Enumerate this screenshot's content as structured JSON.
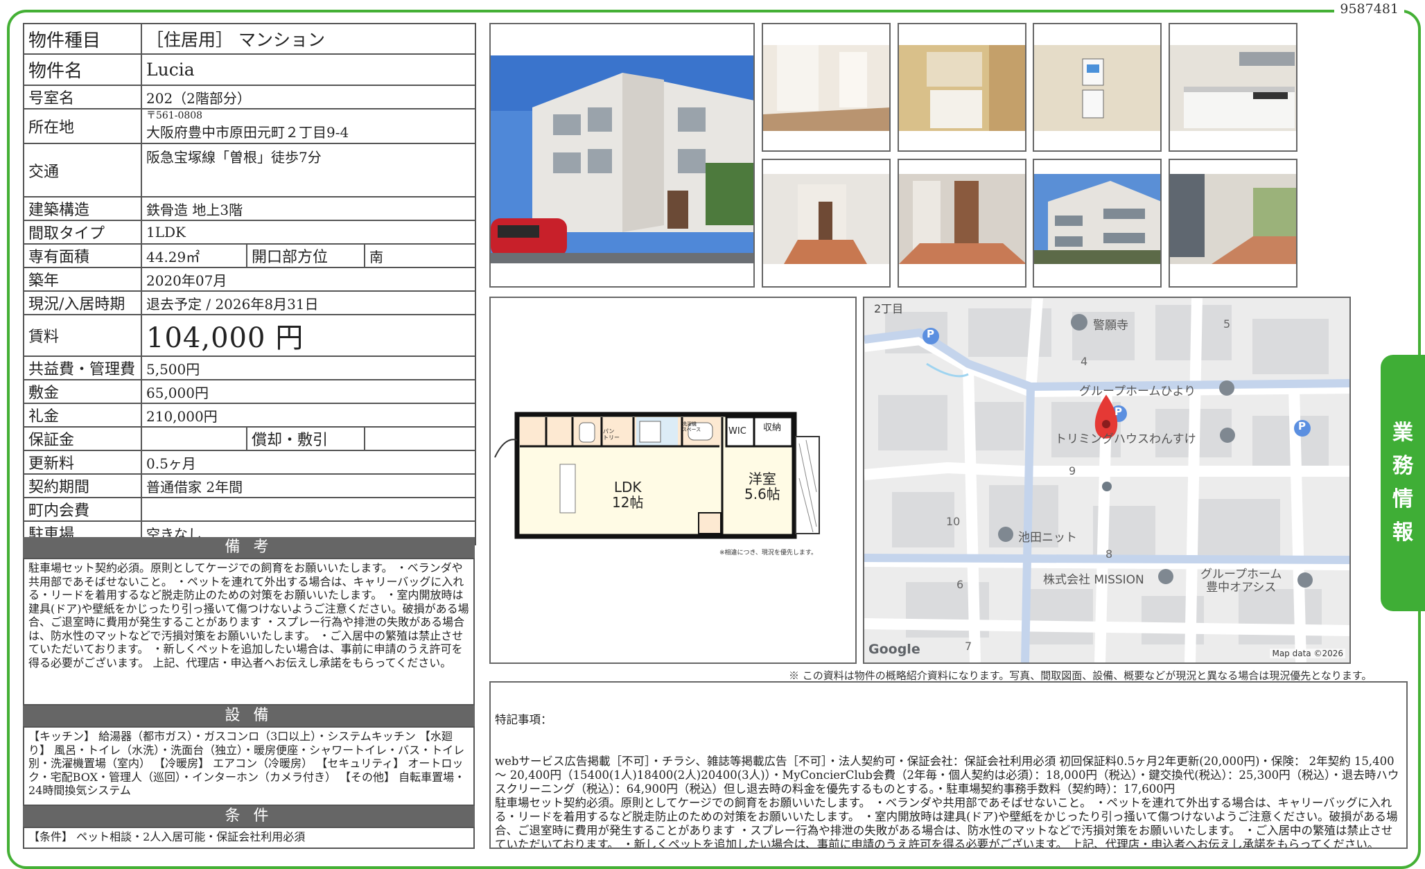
{
  "doc_id": "9587481",
  "side_tab": [
    "業",
    "務",
    "情",
    "報"
  ],
  "info": {
    "type_label": "物件種目",
    "type_value": "［住居用］ マンション",
    "name_label": "物件名",
    "name_value": "Lucia",
    "room_label": "号室名",
    "room_value": "202（2階部分）",
    "addr_label": "所在地",
    "addr_zip": "〒561-0808",
    "addr_value": "大阪府豊中市原田元町２丁目9-4",
    "access_label": "交通",
    "access_value": "阪急宝塚線「曽根」徒歩7分",
    "structure_label": "建築構造",
    "structure_value": "鉄骨造 地上3階",
    "layout_label": "間取タイプ",
    "layout_value": "1LDK",
    "area_label": "専有面積",
    "area_value": "44.29㎡",
    "orient_label": "開口部方位",
    "orient_value": "南",
    "built_label": "築年",
    "built_value": "2020年07月",
    "status_label": "現況/入居時期",
    "status_value": "退去予定 / 2026年8月31日",
    "rent_label": "賃料",
    "rent_value": "104,000",
    "rent_unit": "円",
    "common_label": "共益費・管理費",
    "common_value": "5,500円",
    "deposit_label": "敷金",
    "deposit_value": "65,000円",
    "key_label": "礼金",
    "key_value": "210,000円",
    "guarantee_label": "保証金",
    "guarantee_value": "",
    "amort_label": "償却・敷引",
    "amort_value": "",
    "renewal_label": "更新料",
    "renewal_value": "0.5ヶ月",
    "contract_label": "契約期間",
    "contract_value": "普通借家 2年間",
    "town_label": "町内会費",
    "town_value": "",
    "parking_label": "駐車場",
    "parking_value": "空きなし"
  },
  "remarks": {
    "title": "備 考",
    "text": "駐車場セット契約必須。原則としてケージでの飼育をお願いいたします。 ・ベランダや共用部であそばせないこと。 ・ペットを連れて外出する場合は、キャリーバッグに入れる・リードを着用するなど脱走防止のための対策をお願いいたします。 ・室内開放時は建具(ドア)や壁紙をかじったり引っ掻いて傷つけないようご注意ください。破損がある場合、ご退室時に費用が発生することがあります ・スプレー行為や排泄の失敗がある場合は、防水性のマットなどで汚損対策をお願いいたします。 ・ご入居中の繁殖は禁止させていただいております。 ・新しくペットを追加したい場合は、事前に申請のうえ許可を得る必要がございます。 上記、代理店・申込者へお伝えし承諾をもらってください。"
  },
  "equipment": {
    "title": "設 備",
    "text": "【キッチン】 給湯器（都市ガス）・ガスコンロ（3口以上）・システムキッチン 【水廻り】 風呂・トイレ（水洗）・洗面台（独立）・暖房便座・シャワートイレ・バス・トイレ別・洗濯機置場（室内） 【冷暖房】 エアコン（冷暖房） 【セキュリティ】 オートロック・宅配BOX・管理人（巡回）・インターホン（カメラ付き） 【その他】 自転車置場・24時間換気システム"
  },
  "conditions": {
    "title": "条 件",
    "text": "【条件】 ペット相談・2人入居可能・保証会社利用必須"
  },
  "floorplan": {
    "ldk": "LDK",
    "ldk_size": "12帖",
    "room": "洋室",
    "room_size": "5.6帖",
    "wic": "WIC",
    "storage": "収納",
    "pantry": "パン\nトリー",
    "wash": "洗濯機\nスペース",
    "note": "※相違につき、現況を優先します。"
  },
  "map": {
    "labels": [
      "2丁目",
      "警願寺",
      "グループホームひより",
      "トリミングハウスわんすけ",
      "池田ニット",
      "株式会社 MISSION",
      "グループホーム",
      "豊中オアシス",
      "Google",
      "Map data ©2026"
    ],
    "numbers": [
      "5",
      "4",
      "9",
      "10",
      "8",
      "6",
      "7"
    ],
    "parking_glyph": "P"
  },
  "note": "※ この資料は物件の概略紹介資料になります。写真、間取図面、設備、概要などが現況と異なる場合は現況優先となります。",
  "special": {
    "title": "特記事項：",
    "text": "webサービス広告掲載［不可］・チラシ、雑誌等掲載広告［不可］・法人契約可・保証会社：保証会社利用必須 初回保証料0.5ヶ月2年更新(20,000円)・保険： 2年契約 15,400 〜 20,400円（15400(1人)18400(2人)20400(3人)）・MyConcierClub会費（2年毎・個人契約は必須）：18,000円（税込）・鍵交換代(税込）：25,300円（税込）・退去時ハウスクリーニング（税込）：64,900円（税込）但し退去時の料金を優先するものとする。・駐車場契約事務手数料（契約時）：17,600円\n駐車場セット契約必須。原則としてケージでの飼育をお願いいたします。 ・ベランダや共用部であそばせないこと。 ・ペットを連れて外出する場合は、キャリーバッグに入れる・リードを着用するなど脱走防止のための対策をお願いいたします。 ・室内開放時は建具(ドア)や壁紙をかじったり引っ掻いて傷つけないようご注意ください。破損がある場合、ご退室時に費用が発生することがあります ・スプレー行為や排泄の失敗がある場合は、防水性のマットなどで汚損対策をお願いいたします。 ・ご入居中の繁殖は禁止させていただいております。 ・新しくペットを追加したい場合は、事前に申請のうえ許可を得る必要がございます。 上記、代理店・申込者へお伝えし承諾をもらってください。"
  }
}
